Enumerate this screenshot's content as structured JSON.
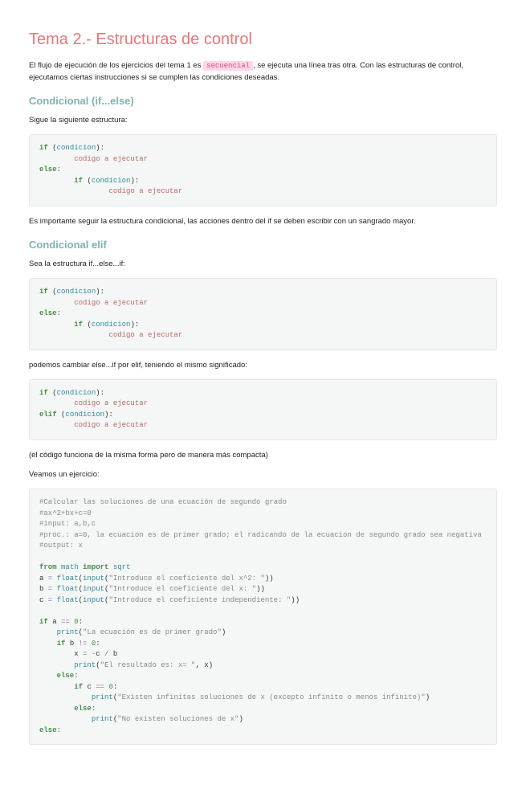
{
  "title": "Tema 2.- Estructuras de control",
  "intro_a": "El flujo de ejecución de los ejercicios del tema 1 es ",
  "intro_hl": "secuencial",
  "intro_b": ", se ejecuta una línea tras otra. Con las estructuras de control, ejecutamos ciertas instrucciones si se cumplen las condiciones deseadas.",
  "h2_cond": "Condicional (if...else)",
  "p_sigue": "Sigue la siguiente estructura:",
  "p_importante": "Es importante seguir la estructura condicional, las acciones dentro del if se deben escribir con un sangrado mayor.",
  "h2_elif": "Condicional elif",
  "p_sea": "Sea la estructura if...else...if:",
  "p_cambiar": "podemos cambiar else...if por elif, teniendo el mismo significado:",
  "p_compacta": "(el código funciona de la misma forma pero de manera más compacta)",
  "p_veamos": "Veamos un ejercicio:",
  "tokens": {
    "if": "if",
    "else": "else:",
    "elif": "elif",
    "condicion": "condicion",
    "codigo": "codigo a ejecutar",
    "lp": "(",
    "rp": "):",
    "from": "from",
    "import": "import",
    "math": "math",
    "sqrt": "sqrt",
    "eq": " = ",
    "float": "float",
    "input": "input",
    "a": "a",
    "b": "b",
    "c": "c",
    "x": "x",
    "print": "print",
    "deq": " == ",
    "ne": " != ",
    "zero": "0",
    "minus": "-",
    "div": " / ",
    "colon": ":",
    "rpp": ")",
    "lpp": "(",
    "comma": ", "
  },
  "strings": {
    "coef_a": "\"Introduce el coeficiente del x^2: \"",
    "coef_b": "\"Introduce el coeficiente del x: \"",
    "coef_c": "\"Introduce el coeficiente independiente: \"",
    "primer": "\"La ecuación es de primer grado\"",
    "resultado": "\"El resultado es: x= \"",
    "infinitas": "\"Existen infinitas soluciones de x (excepto infinito o menos infinito)\"",
    "noexisten": "\"No existen soluciones de x\""
  },
  "comments": {
    "c1": "#Calcular las soluciones de una ecuación de segundo grado",
    "c2": "#ax^2+bx+c=0",
    "c3": "#input: a,b,c",
    "c4": "#proc.: a=0, la ecuacion es de primer grado; el radicando de la ecuacion de segundo grado sea negativa",
    "c5": "#output: x"
  }
}
